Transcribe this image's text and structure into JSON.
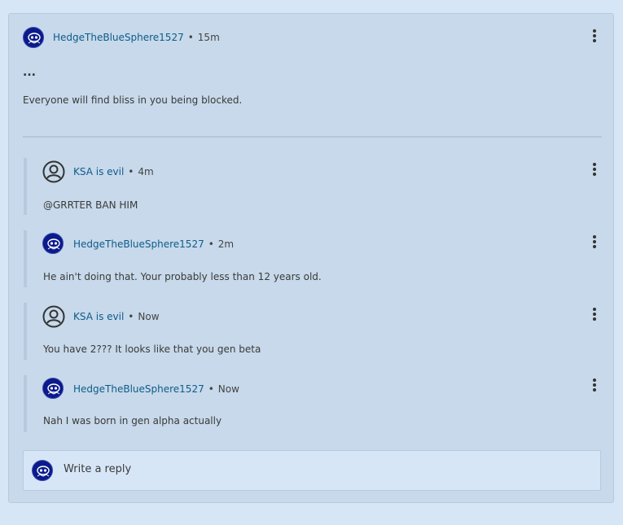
{
  "post": {
    "username": "HedgeTheBlueSphere1527",
    "separator": "•",
    "time": "15m",
    "ellipsis": "...",
    "text": "Everyone will find bliss in you being blocked."
  },
  "replies": [
    {
      "username": "KSA is evil",
      "separator": "•",
      "time": "4m",
      "text": "@GRRTER BAN HIM",
      "avatar": "user-outline-icon"
    },
    {
      "username": "HedgeTheBlueSphere1527",
      "separator": "•",
      "time": "2m",
      "text": "He ain't doing that. Your probably less than 12 years old.",
      "avatar": "blue-sphere-avatar"
    },
    {
      "username": "KSA is evil",
      "separator": "•",
      "time": "Now",
      "text": "You have 2??? It looks like that you gen beta",
      "avatar": "user-outline-icon"
    },
    {
      "username": "HedgeTheBlueSphere1527",
      "separator": "•",
      "time": "Now",
      "text": "Nah I was born in gen alpha actually",
      "avatar": "blue-sphere-avatar"
    }
  ],
  "composer": {
    "placeholder": "Write a reply"
  },
  "colors": {
    "background": "#d7e6f7",
    "card": "#c7d9ea",
    "username": "#0e5b8a"
  }
}
